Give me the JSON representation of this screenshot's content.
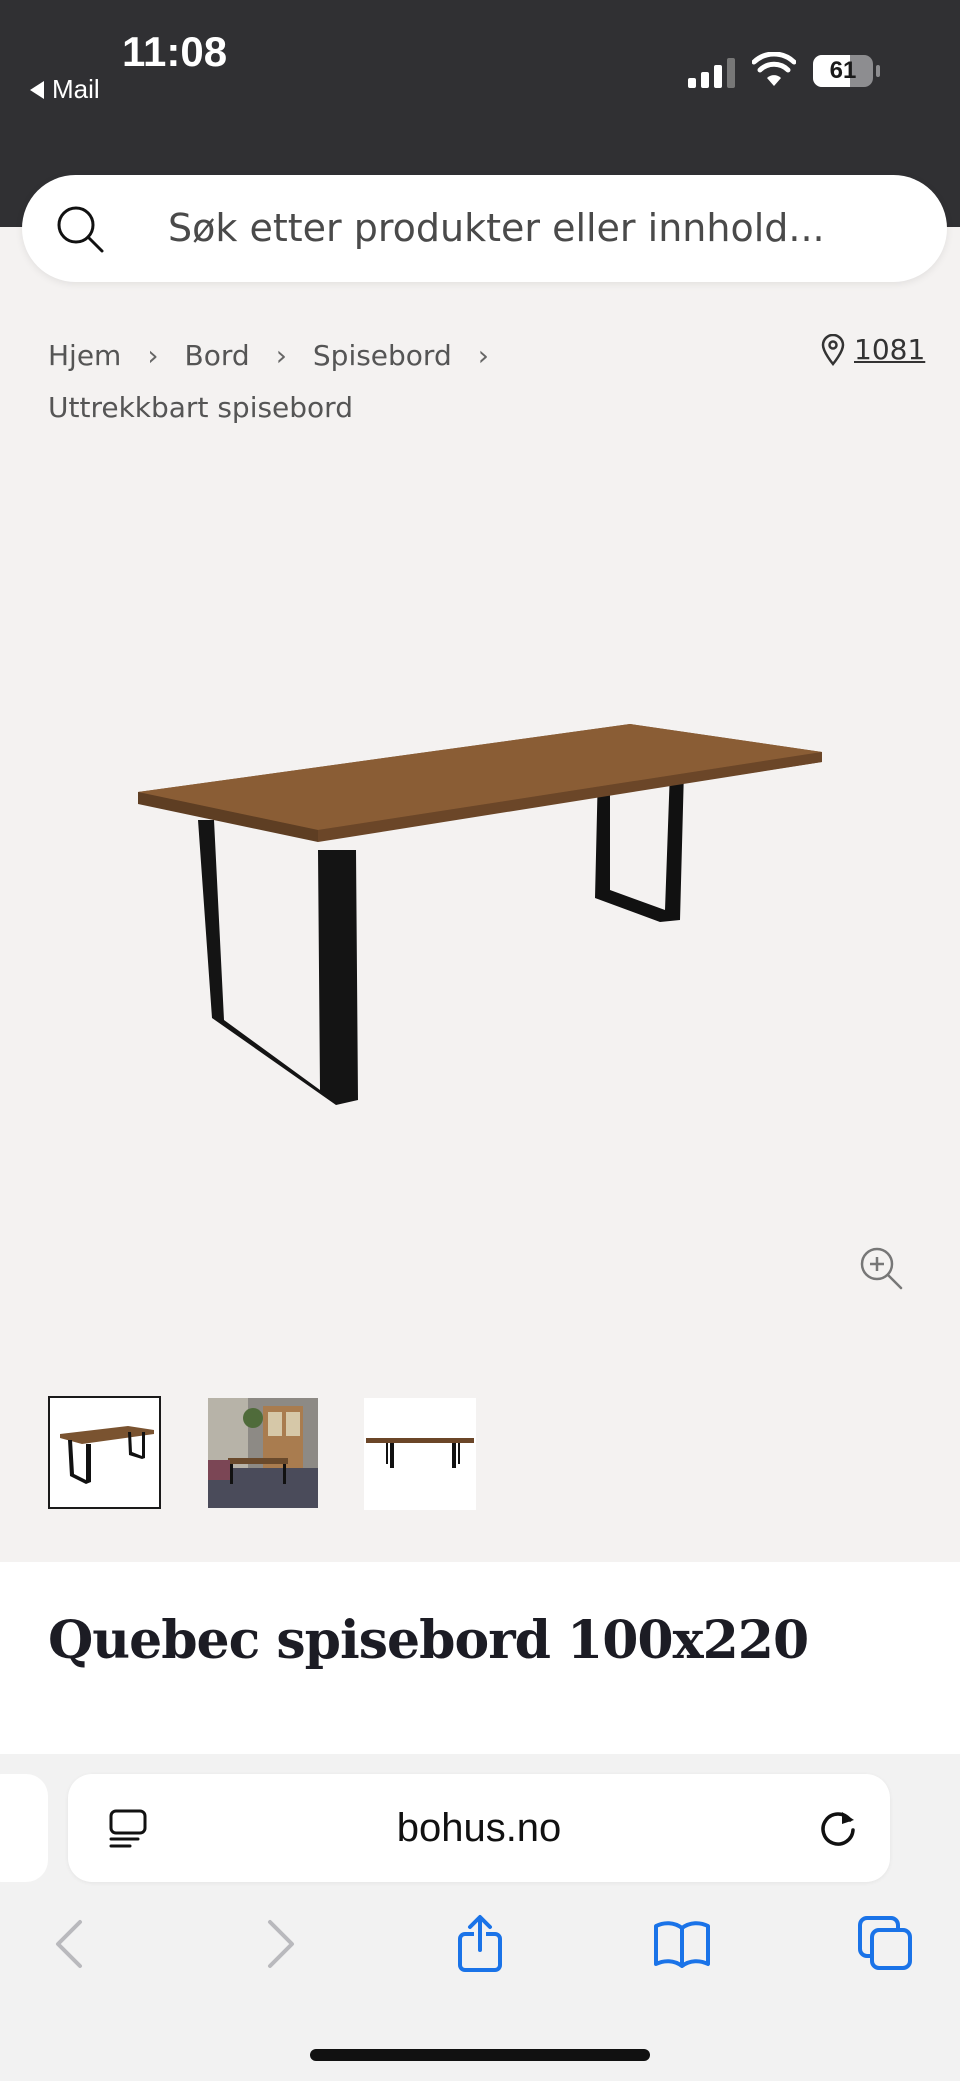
{
  "status_bar": {
    "time": "11:08",
    "back_app": "Mail",
    "battery_level": 61,
    "icons": [
      "cellular-signal-icon",
      "wifi-icon",
      "battery-icon"
    ]
  },
  "search": {
    "placeholder": "Søk etter produkter eller innhold...",
    "value": ""
  },
  "breadcrumb": {
    "items": [
      "Hjem",
      "Bord",
      "Spisebord",
      "Uttrekkbart spisebord"
    ]
  },
  "store": {
    "icon": "location-pin-icon",
    "label": "1081"
  },
  "product": {
    "title": "Quebec spisebord 100x220",
    "thumbnails": [
      {
        "label": "table-image",
        "active": true
      },
      {
        "label": "room-image",
        "active": false
      },
      {
        "label": "table-side-image",
        "active": false
      }
    ]
  },
  "browser": {
    "url": "bohus.no",
    "icons": [
      "reader-icon",
      "reload-icon",
      "back-icon",
      "forward-icon",
      "share-icon",
      "bookmarks-icon",
      "tabs-icon"
    ]
  },
  "colors": {
    "status_bar_bg": "#303033",
    "page_bg": "#f4f2f1",
    "safari_blue": "#1a73e8",
    "title_color": "#1c1c24"
  }
}
